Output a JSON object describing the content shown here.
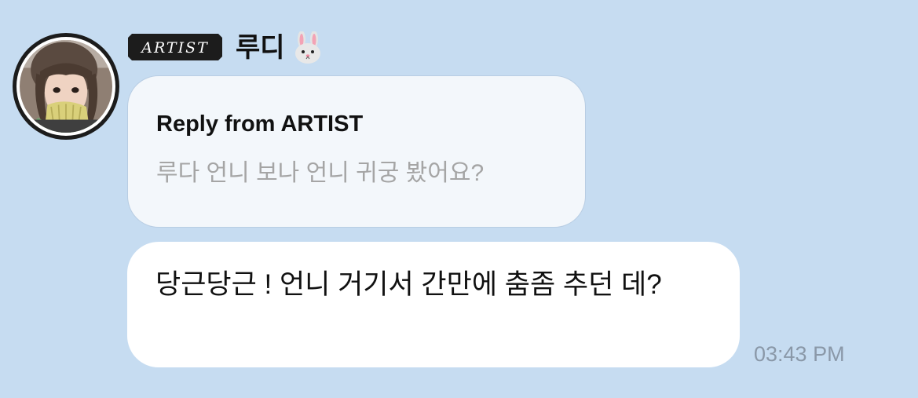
{
  "badge": {
    "label": "ARTIST"
  },
  "sender": {
    "name": "루디",
    "emoji_icon": "rabbit-face-icon"
  },
  "reply": {
    "title": "Reply from ARTIST",
    "quoted_text": "루다 언니 보나 언니 귀궁 봤어요?"
  },
  "message": {
    "text": "당근당근 ! 언니 거기서 간만에 춤좀 추던 데?"
  },
  "timestamp": "03:43 PM",
  "colors": {
    "background": "#c6dcf1",
    "reply_bubble": "#f3f7fb",
    "message_bubble": "#ffffff",
    "quoted_text": "#a5a5a5",
    "timestamp": "#8a98a8",
    "badge": "#1c1c1c"
  }
}
